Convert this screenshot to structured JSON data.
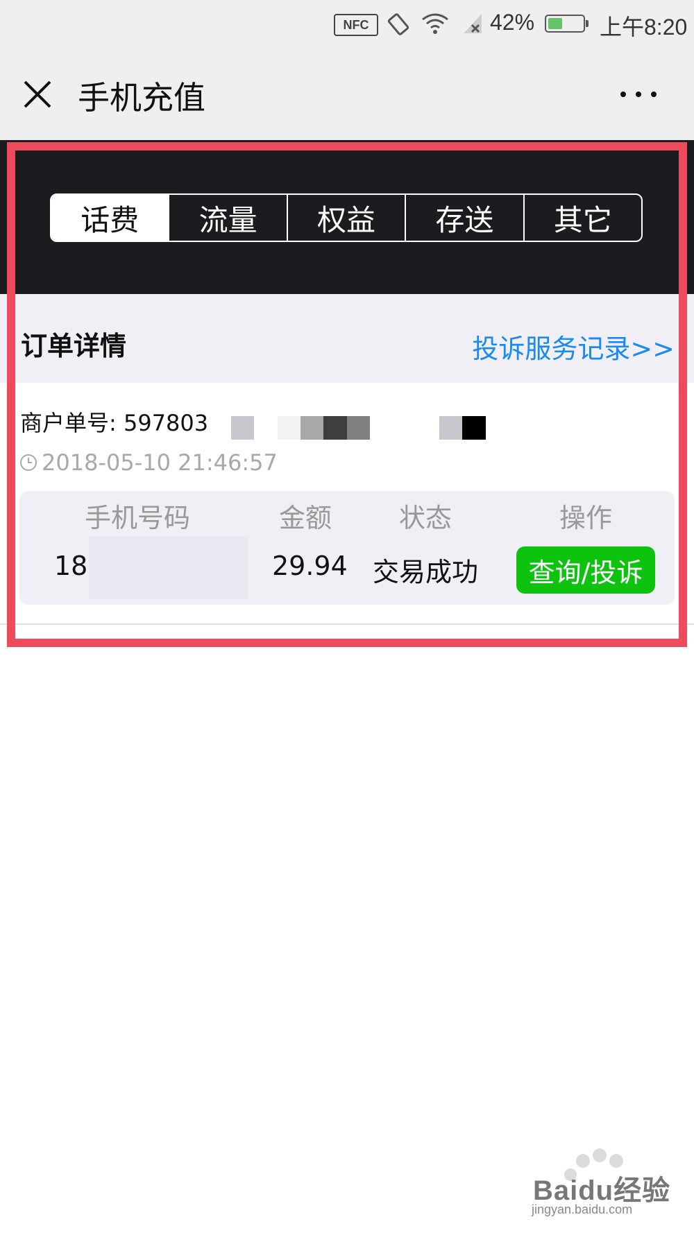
{
  "status_bar": {
    "nfc_label": "NFC",
    "battery_percent": "42%",
    "battery_level": 0.42,
    "time": "上午8:20"
  },
  "header": {
    "title": "手机充值",
    "close_icon": "close-icon",
    "more_icon": "more-horizontal-icon"
  },
  "tabs": [
    {
      "label": "话费",
      "active": true
    },
    {
      "label": "流量",
      "active": false
    },
    {
      "label": "权益",
      "active": false
    },
    {
      "label": "存送",
      "active": false
    },
    {
      "label": "其它",
      "active": false
    }
  ],
  "order": {
    "title": "订单详情",
    "complaint_link": "投诉服务记录>>",
    "merchant_label": "商户单号: 597803",
    "timestamp": "2018-05-10 21:46:57",
    "table": {
      "headers": [
        "手机号码",
        "金额",
        "状态",
        "操作"
      ],
      "row": {
        "phone": "187",
        "amount": "29.94",
        "status": "交易成功",
        "action": "查询/投诉"
      }
    }
  },
  "colors": {
    "accent_link": "#1a8af0",
    "action_green": "#0ec30e",
    "dark_band": "#1c1b20",
    "annotation_red": "#ee4b5c"
  },
  "watermark": {
    "text": "Baidu经验",
    "sub": "jingyan.baidu.com"
  }
}
